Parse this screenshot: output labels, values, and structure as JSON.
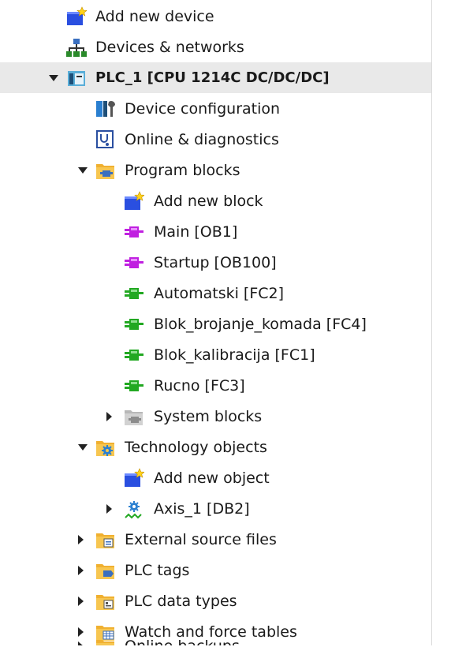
{
  "tree": {
    "items": [
      {
        "label": "Add new device",
        "icon": "add-new-icon"
      },
      {
        "label": "Devices & networks",
        "icon": "network-icon"
      },
      {
        "label": "PLC_1 [CPU 1214C DC/DC/DC]",
        "icon": "plc-icon",
        "expanded": true,
        "selected": true
      },
      {
        "label": "Device configuration",
        "icon": "device-config-icon"
      },
      {
        "label": "Online & diagnostics",
        "icon": "diagnostics-icon"
      },
      {
        "label": "Program blocks",
        "icon": "folder-blocks-icon",
        "expanded": true
      },
      {
        "label": "Add new block",
        "icon": "add-new-icon"
      },
      {
        "label": "Main [OB1]",
        "icon": "ob-block-icon"
      },
      {
        "label": "Startup [OB100]",
        "icon": "ob-block-icon"
      },
      {
        "label": "Automatski [FC2]",
        "icon": "fc-block-icon"
      },
      {
        "label": "Blok_brojanje_komada [FC4]",
        "icon": "fc-block-icon"
      },
      {
        "label": "Blok_kalibracija [FC1]",
        "icon": "fc-block-icon"
      },
      {
        "label": "Rucno [FC3]",
        "icon": "fc-block-icon"
      },
      {
        "label": "System blocks",
        "icon": "folder-system-icon",
        "expanded": false
      },
      {
        "label": "Technology objects",
        "icon": "folder-technology-icon",
        "expanded": true
      },
      {
        "label": "Add new object",
        "icon": "add-new-icon"
      },
      {
        "label": "Axis_1 [DB2]",
        "icon": "axis-icon",
        "expanded": false
      },
      {
        "label": "External source files",
        "icon": "folder-external-icon",
        "expanded": false
      },
      {
        "label": "PLC tags",
        "icon": "folder-tags-icon",
        "expanded": false
      },
      {
        "label": "PLC data types",
        "icon": "folder-datatypes-icon",
        "expanded": false
      },
      {
        "label": "Watch and force tables",
        "icon": "folder-watch-icon",
        "expanded": false
      },
      {
        "label": "Online backups",
        "icon": "folder-backups-icon",
        "expanded": false
      }
    ]
  },
  "colors": {
    "ob_block": "#c020e0",
    "fc_block": "#22a822",
    "add_new": "#2a4fe0",
    "folder": "#f0b030",
    "selected_row": "#e9e9e9"
  }
}
